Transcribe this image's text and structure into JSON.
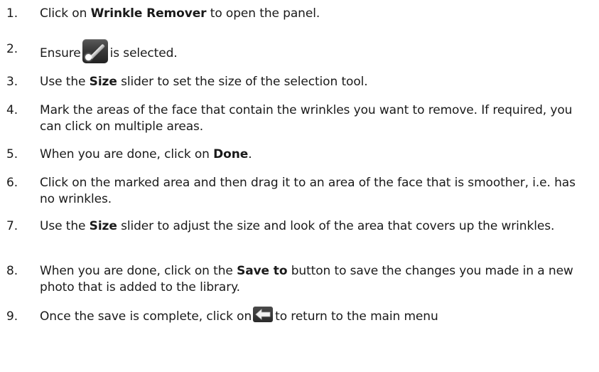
{
  "steps": [
    {
      "num": "1.",
      "pre": "Click on ",
      "bold": "Wrinkle Remover",
      "post": " to open the panel."
    },
    {
      "num": "2.",
      "pre": "Ensure",
      "icon": "wand-brush-icon",
      "post": "is selected."
    },
    {
      "num": "3.",
      "pre": "Use the ",
      "bold": "Size",
      "post": " slider to set the size of the selection tool."
    },
    {
      "num": "4.",
      "text": "Mark the areas of the face that contain the wrinkles you want to remove. If required, you can click on multiple areas."
    },
    {
      "num": "5.",
      "pre": "When you are done, click on ",
      "bold": "Done",
      "post": "."
    },
    {
      "num": "6.",
      "text": "Click on the marked area and then drag it to an area of the face that is smoother, i.e. has no wrinkles."
    },
    {
      "num": "7.",
      "pre": "Use the ",
      "bold": "Size",
      "post": " slider to adjust the size and look of the area that covers up the wrinkles."
    },
    {
      "num": "8.",
      "pre": "When you are done, click on the ",
      "bold": "Save to",
      "post": " button to save the changes you made in a new photo that is added to the library."
    },
    {
      "num": "9.",
      "pre": "Once the save is complete, click on",
      "icon": "back-arrow-icon",
      "post": "to return to the main menu"
    }
  ],
  "colors": {
    "text": "#1a1a1a",
    "icon_dark": "#333333",
    "icon_light": "#ffffff"
  }
}
